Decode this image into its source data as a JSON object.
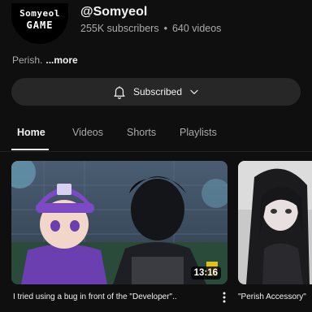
{
  "channel": {
    "avatar_line1": "Somyeol",
    "avatar_line2": "GAME",
    "handle": "@Somyeol",
    "subscribers": "255K subscribers",
    "separator": "•",
    "videos": "640 videos",
    "description": "Perish.",
    "more_label": "...more"
  },
  "subscribe_button": {
    "label": "Subscribed",
    "icon": "bell-icon",
    "dropdown_icon": "chevron-down-icon"
  },
  "tabs": [
    {
      "label": "Home",
      "active": true
    },
    {
      "label": "Videos",
      "active": false
    },
    {
      "label": "Shorts",
      "active": false
    },
    {
      "label": "Playlists",
      "active": false
    }
  ],
  "videos": [
    {
      "title": "I tried using a bug in front of the \"Developer\"..",
      "duration": "13:16"
    },
    {
      "title": "\"Perish Accessory\""
    }
  ],
  "colors": {
    "background": "#0f0f0f",
    "button_bg": "#272727",
    "text_primary": "#f1f1f1",
    "text_secondary": "#aaaaaa"
  }
}
